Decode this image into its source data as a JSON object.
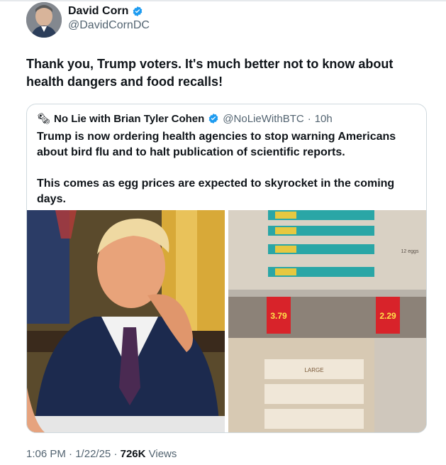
{
  "author": {
    "name": "David Corn",
    "handle": "@DavidCornDC",
    "avatar_icon": "person-avatar",
    "verified_icon": "verified-badge-icon"
  },
  "tweet": {
    "text": "Thank you, Trump voters. It's much better not to know about health dangers and food recalls!"
  },
  "quote": {
    "emoji": "🗞",
    "name": "No Lie with Brian Tyler Cohen",
    "handle": "@NoLieWithBTC",
    "separator": "·",
    "time": "10h",
    "paragraph1": "Trump is now ordering health agencies to stop warning Americans about bird flu and to halt publication of scientific reports.",
    "paragraph2": "This comes as egg prices are expected to skyrocket in the coming days."
  },
  "media": {
    "left_image": "photo-man-in-suit",
    "right_image": "photo-egg-shelves",
    "prices": [
      "3.79",
      "2.29"
    ],
    "carton_text": "LARGE",
    "carton_count": "12 eggs"
  },
  "footer": {
    "time": "1:06 PM",
    "date": "1/22/25",
    "views_count": "726K",
    "views_label": "Views",
    "separator": "·"
  },
  "colors": {
    "text": "#0f1419",
    "secondary": "#536471",
    "verified": "#1d9bf0",
    "border": "#cfd9de",
    "price_tag": "#d8232a"
  }
}
